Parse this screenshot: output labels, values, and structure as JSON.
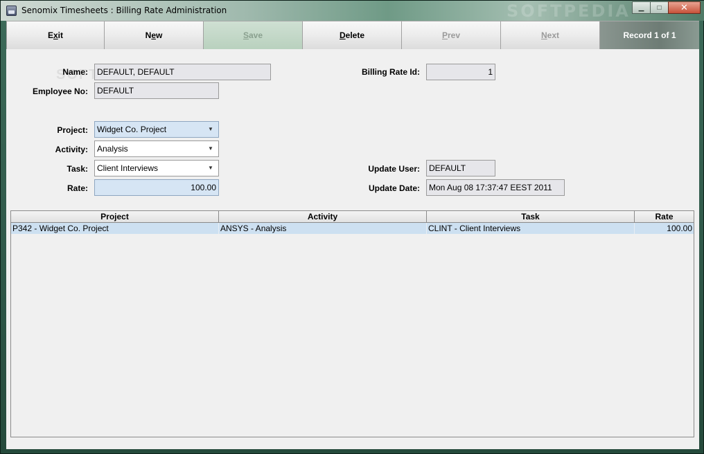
{
  "window": {
    "title": "Senomix Timesheets : Billing Rate Administration",
    "watermark": "SOFTPEDIA",
    "minimize": "▁",
    "maximize": "□",
    "close": "✕"
  },
  "toolbar": {
    "buttons": [
      {
        "label": "Exit",
        "mnemonic": "x",
        "state": "enabled"
      },
      {
        "label": "New",
        "mnemonic": "e",
        "state": "enabled"
      },
      {
        "label": "Save",
        "mnemonic": "S",
        "state": "disabled"
      },
      {
        "label": "Delete",
        "mnemonic": "D",
        "state": "enabled"
      },
      {
        "label": "Prev",
        "mnemonic": "P",
        "state": "disabled"
      },
      {
        "label": "Next",
        "mnemonic": "N",
        "state": "disabled"
      }
    ],
    "record": "Record 1 of 1"
  },
  "form": {
    "name_label": "Name:",
    "name_value": "DEFAULT, DEFAULT",
    "employee_label": "Employee No:",
    "employee_value": "DEFAULT",
    "billing_rate_id_label": "Billing Rate Id:",
    "billing_rate_id_value": "1",
    "project_label": "Project:",
    "project_value": "Widget Co. Project",
    "activity_label": "Activity:",
    "activity_value": "Analysis",
    "task_label": "Task:",
    "task_value": "Client Interviews",
    "rate_label": "Rate:",
    "rate_value": "100.00",
    "update_user_label": "Update User:",
    "update_user_value": "DEFAULT",
    "update_date_label": "Update Date:",
    "update_date_value": "Mon Aug 08 17:37:47 EEST 2011"
  },
  "table": {
    "columns": [
      "Project",
      "Activity",
      "Task",
      "Rate"
    ],
    "rows": [
      [
        "P342 - Widget Co. Project",
        "ANSYS - Analysis",
        "CLINT - Client Interviews",
        "100.00"
      ]
    ]
  },
  "colors": {
    "selected_row": "#cde0f1",
    "highlight_field": "#d6e5f4",
    "readonly_field": "#e6e6ea"
  }
}
